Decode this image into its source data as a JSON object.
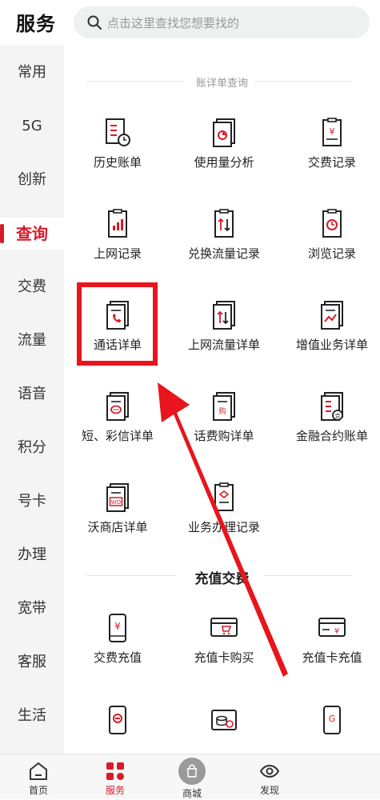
{
  "header": {
    "title": "服务",
    "search_placeholder": "点击这里查找您想要找的"
  },
  "sidebar": {
    "items": [
      {
        "label": "常用"
      },
      {
        "label": "5G"
      },
      {
        "label": "创新"
      },
      {
        "label": "查询",
        "active": true
      },
      {
        "label": "交费"
      },
      {
        "label": "流量"
      },
      {
        "label": "语音"
      },
      {
        "label": "积分"
      },
      {
        "label": "号卡"
      },
      {
        "label": "办理"
      },
      {
        "label": "宽带"
      },
      {
        "label": "客服"
      },
      {
        "label": "生活"
      }
    ]
  },
  "sections": {
    "bill_query": {
      "title": "账详单查询",
      "items": [
        {
          "label": "历史账单",
          "icon": "history-bill-icon"
        },
        {
          "label": "使用量分析",
          "icon": "usage-analysis-icon"
        },
        {
          "label": "交费记录",
          "icon": "payment-record-icon"
        },
        {
          "label": "上网记录",
          "icon": "internet-record-icon"
        },
        {
          "label": "兑换流量记录",
          "icon": "data-exchange-icon"
        },
        {
          "label": "浏览记录",
          "icon": "browse-history-icon"
        },
        {
          "label": "通话详单",
          "icon": "call-detail-icon"
        },
        {
          "label": "上网流量详单",
          "icon": "data-detail-icon"
        },
        {
          "label": "增值业务详单",
          "icon": "value-added-icon"
        },
        {
          "label": "短、彩信详单",
          "icon": "sms-detail-icon"
        },
        {
          "label": "话费购详单",
          "icon": "purchase-detail-icon"
        },
        {
          "label": "金融合约账单",
          "icon": "finance-contract-icon"
        },
        {
          "label": "沃商店详单",
          "icon": "wo-store-icon"
        },
        {
          "label": "业务办理记录",
          "icon": "business-record-icon"
        }
      ]
    },
    "recharge": {
      "title": "充值交费",
      "items": [
        {
          "label": "交费充值",
          "icon": "phone-recharge-icon"
        },
        {
          "label": "充值卡购买",
          "icon": "card-purchase-icon"
        },
        {
          "label": "充值卡充值",
          "icon": "card-recharge-icon"
        }
      ]
    }
  },
  "tabbar": {
    "items": [
      {
        "label": "首页",
        "icon": "home-icon"
      },
      {
        "label": "服务",
        "icon": "service-icon",
        "active": true
      },
      {
        "label": "商城",
        "icon": "mall-icon"
      },
      {
        "label": "发现",
        "icon": "discover-icon"
      }
    ]
  },
  "colors": {
    "accent": "#d61c29",
    "highlight_box": "#e8151c",
    "arrow": "#e8151c"
  }
}
